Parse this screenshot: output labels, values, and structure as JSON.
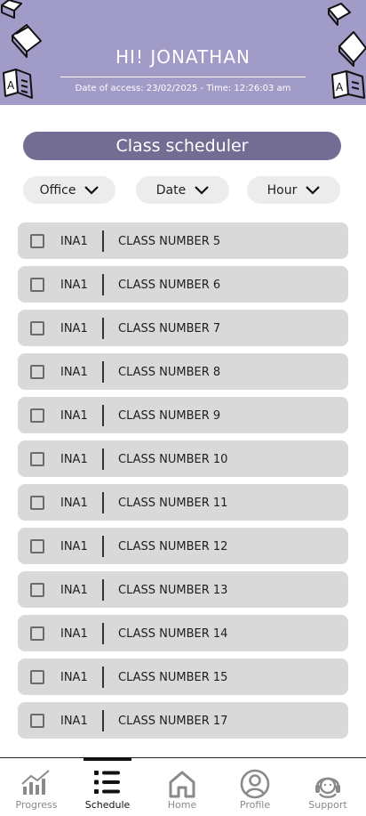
{
  "header": {
    "greeting": "HI! JONATHAN",
    "access_text": "Date of access: 23/02/2025 - Time: 12:26:03 am",
    "background_color": "#a19bc8"
  },
  "title": "Class scheduler",
  "filters": [
    {
      "label": "Office"
    },
    {
      "label": "Date"
    },
    {
      "label": "Hour"
    }
  ],
  "classes": [
    {
      "code": "INA1",
      "name": "CLASS NUMBER 5",
      "checked": false
    },
    {
      "code": "INA1",
      "name": "CLASS NUMBER 6",
      "checked": false
    },
    {
      "code": "INA1",
      "name": "CLASS NUMBER 7",
      "checked": false
    },
    {
      "code": "INA1",
      "name": "CLASS NUMBER 8",
      "checked": false
    },
    {
      "code": "INA1",
      "name": "CLASS NUMBER 9",
      "checked": false
    },
    {
      "code": "INA1",
      "name": "CLASS NUMBER 10",
      "checked": false
    },
    {
      "code": "INA1",
      "name": "CLASS NUMBER 11",
      "checked": false
    },
    {
      "code": "INA1",
      "name": "CLASS NUMBER 12",
      "checked": false
    },
    {
      "code": "INA1",
      "name": "CLASS NUMBER 13",
      "checked": false
    },
    {
      "code": "INA1",
      "name": "CLASS NUMBER 14",
      "checked": false
    },
    {
      "code": "INA1",
      "name": "CLASS NUMBER 15",
      "checked": false
    },
    {
      "code": "INA1",
      "name": "CLASS NUMBER 17",
      "checked": false
    }
  ],
  "nav": {
    "active": "Schedule",
    "items": [
      {
        "label": "Progress",
        "icon": "chart-icon"
      },
      {
        "label": "Schedule",
        "icon": "list-icon"
      },
      {
        "label": "Home",
        "icon": "home-icon"
      },
      {
        "label": "Profile",
        "icon": "profile-icon"
      },
      {
        "label": "Support",
        "icon": "support-icon"
      }
    ]
  }
}
